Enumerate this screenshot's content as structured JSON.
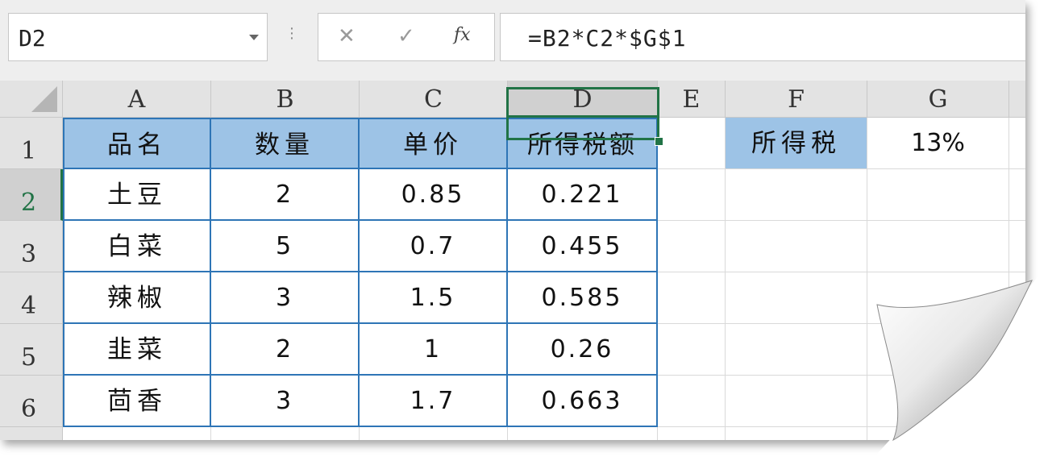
{
  "name_box": {
    "value": "D2"
  },
  "formula_bar": {
    "cancel_icon": "close-icon",
    "enter_icon": "check-icon",
    "fx_label": "fx",
    "formula": "=B2*C2*$G$1"
  },
  "columns": [
    "A",
    "B",
    "C",
    "D",
    "E",
    "F",
    "G"
  ],
  "rows": [
    "1",
    "2",
    "3",
    "4",
    "5",
    "6"
  ],
  "selected_cell": "D2",
  "table": {
    "headers": [
      "品名",
      "数量",
      "单价",
      "所得税额"
    ],
    "rows": [
      [
        "土豆",
        "2",
        "0.85",
        "0.221"
      ],
      [
        "白菜",
        "5",
        "0.7",
        "0.455"
      ],
      [
        "辣椒",
        "3",
        "1.5",
        "0.585"
      ],
      [
        "韭菜",
        "2",
        "1",
        "0.26"
      ],
      [
        "茴香",
        "3",
        "1.7",
        "0.663"
      ]
    ]
  },
  "tax": {
    "label": "所得税",
    "rate": "13%"
  },
  "colors": {
    "header_fill": "#9dc3e6",
    "table_border": "#2e75b6",
    "selection": "#217346"
  }
}
